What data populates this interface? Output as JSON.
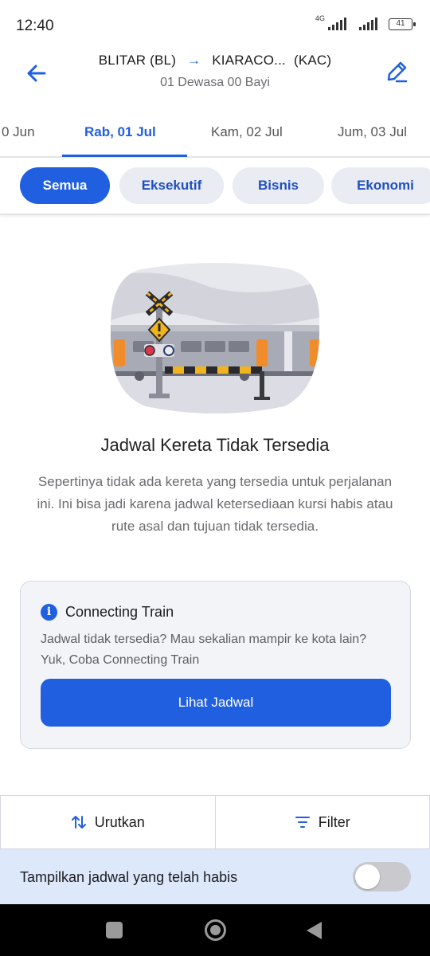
{
  "status_bar": {
    "time": "12:40",
    "network": "4G",
    "battery": "41"
  },
  "header": {
    "origin": "BLITAR (BL)",
    "destination_name": "KIARACO...",
    "destination_code": "(KAC)",
    "passengers": "01 Dewasa 00 Bayi",
    "back_icon": "arrow-left-icon",
    "edit_icon": "pencil-icon"
  },
  "date_tabs": [
    {
      "label": "0 Jun",
      "active": false
    },
    {
      "label": "Rab, 01 Jul",
      "active": true
    },
    {
      "label": "Kam, 02 Jul",
      "active": false
    },
    {
      "label": "Jum, 03 Jul",
      "active": false
    }
  ],
  "class_chips": [
    {
      "label": "Semua",
      "active": true
    },
    {
      "label": "Eksekutif",
      "active": false
    },
    {
      "label": "Bisnis",
      "active": false
    },
    {
      "label": "Ekonomi",
      "active": false
    }
  ],
  "empty_state": {
    "title": "Jadwal Kereta Tidak Tersedia",
    "description": "Sepertinya tidak ada kereta yang tersedia untuk perjalanan ini. Ini bisa jadi karena jadwal ketersediaan kursi habis atau rute asal dan tujuan tidak tersedia."
  },
  "connecting_train": {
    "icon": "info-icon",
    "title": "Connecting Train",
    "description": "Jadwal tidak tersedia? Mau sekalian mampir ke kota lain? Yuk, Coba Connecting Train",
    "button_label": "Lihat Jadwal"
  },
  "actions": {
    "sort_label": "Urutkan",
    "sort_icon": "sort-arrows-icon",
    "filter_label": "Filter",
    "filter_icon": "filter-lines-icon"
  },
  "show_sold_out": {
    "label": "Tampilkan jadwal yang telah habis",
    "enabled": false
  },
  "colors": {
    "primary": "#1f5fe0",
    "chip_bg": "#eaecf3",
    "card_bg": "#f3f4f8",
    "toggle_row_bg": "#dde8fb"
  }
}
